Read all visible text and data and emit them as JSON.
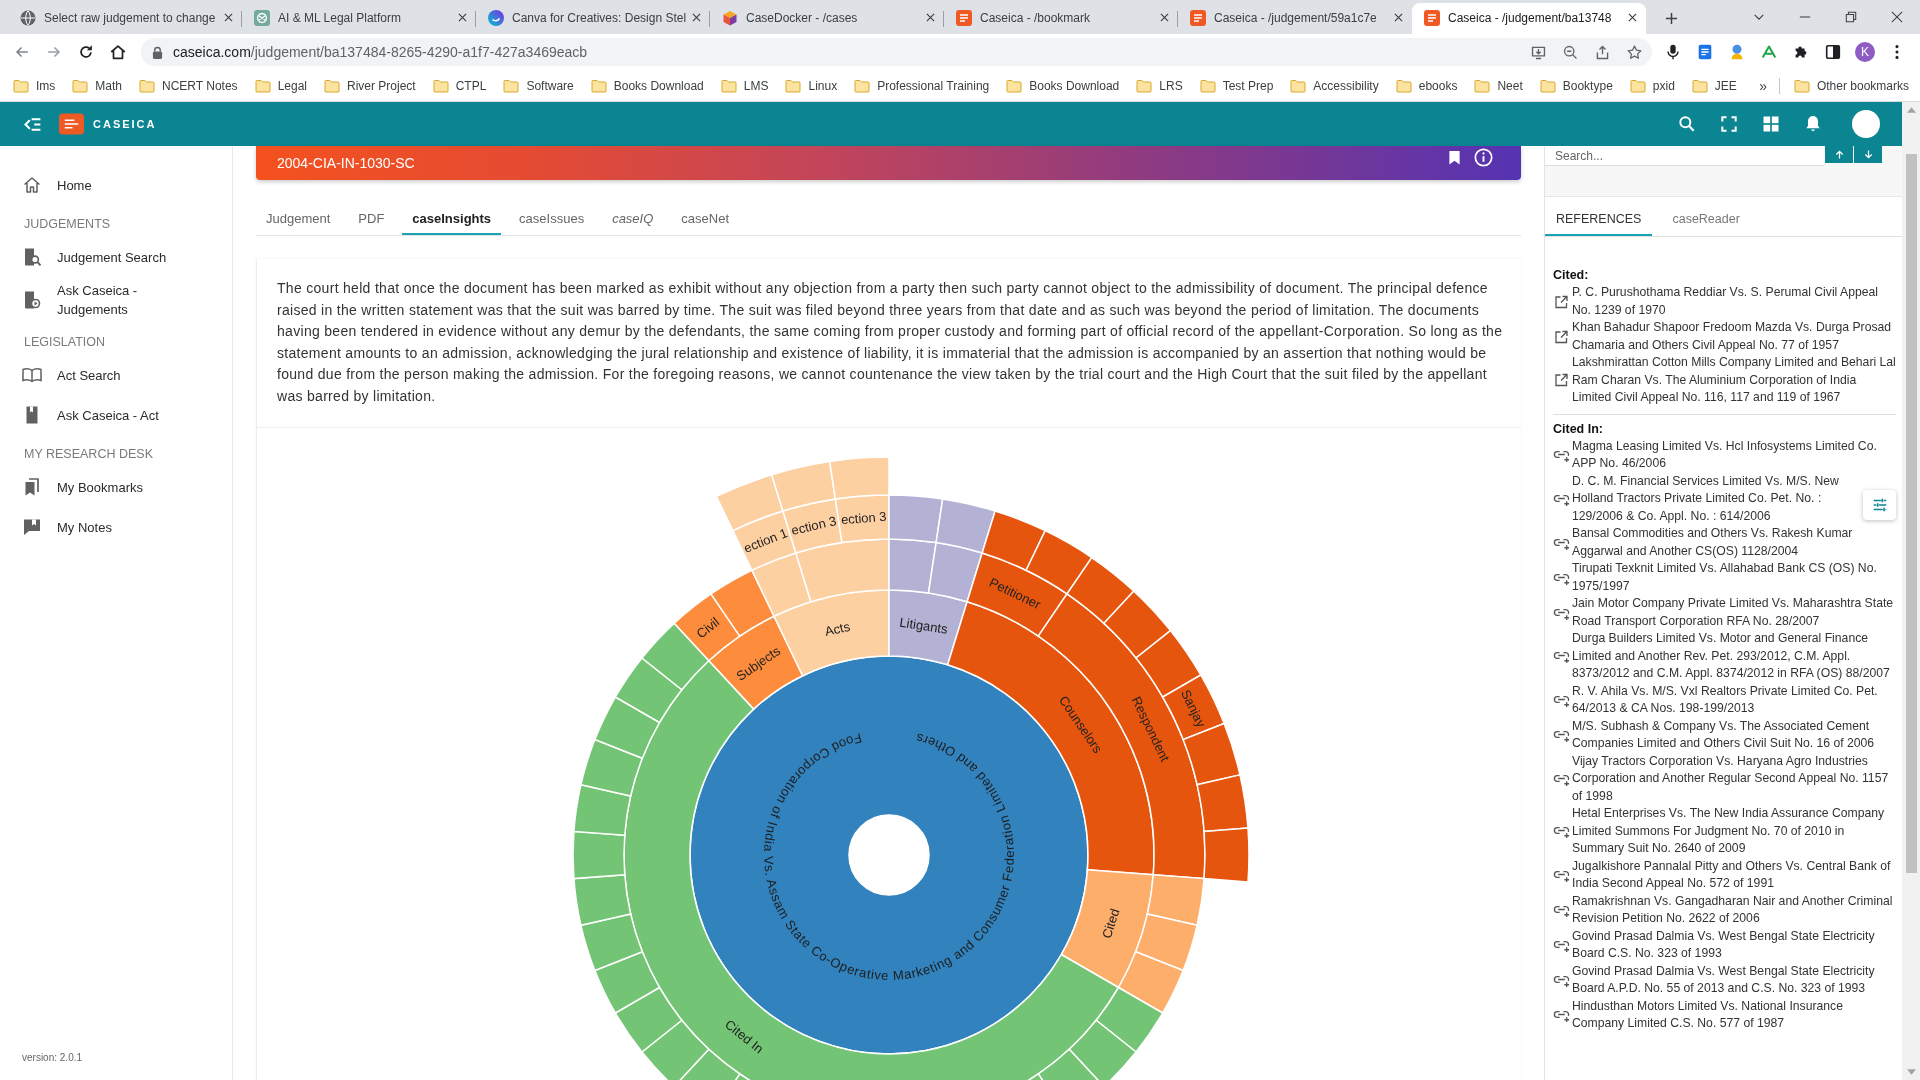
{
  "browser": {
    "tabs": [
      {
        "title": "Select raw judgement to change",
        "selected": false
      },
      {
        "title": "AI & ML Legal Platform",
        "selected": false
      },
      {
        "title": "Canva for Creatives: Design Stel",
        "selected": false
      },
      {
        "title": "CaseDocker - /cases",
        "selected": false
      },
      {
        "title": "Caseica - /bookmark",
        "selected": false
      },
      {
        "title": "Caseica - /judgement/59a1c7e",
        "selected": false
      },
      {
        "title": "Caseica - /judgement/ba13748",
        "selected": true
      }
    ],
    "address": {
      "host": "caseica.com",
      "path": "/judgement/ba137484-8265-4290-a1f7-427a3469eacb"
    },
    "profile_initial": "K",
    "bookmarks": [
      "Ims",
      "Math",
      "NCERT Notes",
      "Legal",
      "River Project",
      "CTPL",
      "Software",
      "Books Download",
      "LMS",
      "Linux",
      "Professional Training",
      "Books Download",
      "LRS",
      "Test Prep",
      "Accessibility",
      "ebooks",
      "Neet",
      "Booktype",
      "pxid",
      "JEE"
    ],
    "overflow_button": "»",
    "other_bookmarks": "Other bookmarks"
  },
  "app": {
    "brand": "CASEICA"
  },
  "sidebar": {
    "items": [
      {
        "kind": "link",
        "label": "Home"
      },
      {
        "kind": "heading",
        "label": "JUDGEMENTS"
      },
      {
        "kind": "link",
        "label": "Judgement Search"
      },
      {
        "kind": "link",
        "label": "Ask Caseica - Judgements"
      },
      {
        "kind": "heading",
        "label": "LEGISLATION"
      },
      {
        "kind": "link",
        "label": "Act Search"
      },
      {
        "kind": "link",
        "label": "Ask Caseica - Act"
      },
      {
        "kind": "heading",
        "label": "MY RESEARCH DESK"
      },
      {
        "kind": "link",
        "label": "My Bookmarks"
      },
      {
        "kind": "link",
        "label": "My Notes"
      }
    ],
    "version": "version: 2.0.1"
  },
  "judgement": {
    "citation": "2004-CIA-IN-1030-SC",
    "tabs": [
      {
        "label": "Judgement",
        "selected": false,
        "italic": false
      },
      {
        "label": "PDF",
        "selected": false,
        "italic": false
      },
      {
        "label": "caseInsights",
        "selected": true,
        "italic": false
      },
      {
        "label": "caseIssues",
        "selected": false,
        "italic": false
      },
      {
        "label": "caseIQ",
        "selected": false,
        "italic": true
      },
      {
        "label": "caseNet",
        "selected": false,
        "italic": false
      }
    ],
    "insight": "The court held that once the document has been marked as exhibit without any objection from a party then such party cannot object to the admissibility of document. The principal defence raised in the written statement was that the suit was barred by time. The suit was filed beyond three years from that date and as such was beyond the period of limitation. The documents having been tendered in evidence without any demur by the defendants, the same coming from proper custody and forming part of official record of the appellant-Corporation. So long as the statement amounts to an admission, acknowledging the jural relationship and existence of liability, it is immaterial that the admission is accompanied by an assertion that nothing would be found due from the person making the admission. For the foregoing reasons, we cannot countenance the view taken by the trial court and the High Court that the suit filed by the appellant was barred by limitation.",
    "sunburst": {
      "center_label": "Food Corporation of India Vs. Assam State Co-Operative Marketing and Consumer Federation Limited and Others",
      "branches": [
        {
          "label": "Subjects",
          "color": "#fd8d3c",
          "sub_labels": [
            "Civil"
          ]
        },
        {
          "label": "Acts",
          "color": "#fdd0a2",
          "sub_labels": [
            "ection 1",
            "ection 3",
            "ection 3"
          ]
        },
        {
          "label": "Litigants",
          "color": "#b4b2d4"
        },
        {
          "label": "Counselors",
          "color": "#e6550d",
          "sub_labels": [
            "Petitioner",
            "Respondent",
            "Sanjay"
          ]
        },
        {
          "label": "Cited",
          "color": "#fdae6b"
        },
        {
          "label": "Cited In",
          "color": "#74c476"
        }
      ]
    }
  },
  "references": {
    "search_placeholder": "Search...",
    "tabs": [
      {
        "label": "REFERENCES",
        "selected": true
      },
      {
        "label": "caseReader",
        "selected": false
      }
    ],
    "cited_heading": "Cited:",
    "cited": [
      "P. C. Purushothama Reddiar Vs. S. Perumal Civil Appeal No. 1239 of 1970",
      "Khan Bahadur Shapoor Fredoom Mazda Vs. Durga Prosad Chamaria and Others Civil Appeal No. 77 of 1957",
      "Lakshmirattan Cotton Mills Company Limited and Behari Lal Ram Charan Vs. The Aluminium Corporation of India Limited Civil Appeal No. 116, 117 and 119 of 1967"
    ],
    "cited_in_heading": "Cited In:",
    "cited_in": [
      "Magma Leasing Limited Vs. Hcl Infosystems Limited Co. APP No. 46/2006",
      "D. C. M. Financial Services Limited Vs. M/S. New Holland Tractors Private Limited Co. Pet. No. : 129/2006 & Co. Appl. No. : 614/2006",
      "Bansal Commodities and Others Vs. Rakesh Kumar Aggarwal and Another CS(OS) 1128/2004",
      "Tirupati Texknit Limited Vs. Allahabad Bank CS (OS) No. 1975/1997",
      "Jain Motor Company Private Limited Vs. Maharashtra State Road Transport Corporation RFA No. 28/2007",
      "Durga Builders Limited Vs. Motor and General Finance Limited and Another Rev. Pet. 293/2012, C.M. Appl. 8373/2012 and C.M. Appl. 8374/2012 in RFA (OS) 88/2007",
      "R. V. Ahila Vs. M/S. Vxl Realtors Private Limited Co. Pet. 64/2013 & CA Nos. 198-199/2013",
      "M/S. Subhash & Company Vs. The Associated Cement Companies Limited and Others Civil Suit No. 16 of 2006",
      "Vijay Tractors Corporation Vs. Haryana Agro Industries Corporation and Another Regular Second Appeal No. 1157 of 1998",
      "Hetal Enterprises Vs. The New India Assurance Company Limited Summons For Judgment No. 70 of 2010 in Summary Suit No. 2640 of 2009",
      "Jugalkishore Pannalal Pitty and Others Vs. Central Bank of India Second Appeal No. 572 of 1991",
      "Ramakrishnan Vs. Gangadharan Nair and Another Criminal Revision Petition No. 2622 of 2006",
      "Govind Prasad Dalmia Vs. West Bengal State Electricity Board C.S. No. 323 of 1993",
      "Govind Prasad Dalmia Vs. West Bengal State Electricity Board A.P.D. No. 55 of 2013 and C.S. No. 323 of 1993",
      "Hindusthan Motors Limited Vs. National Insurance Company Limited C.S. No. 577 of 1987"
    ]
  }
}
